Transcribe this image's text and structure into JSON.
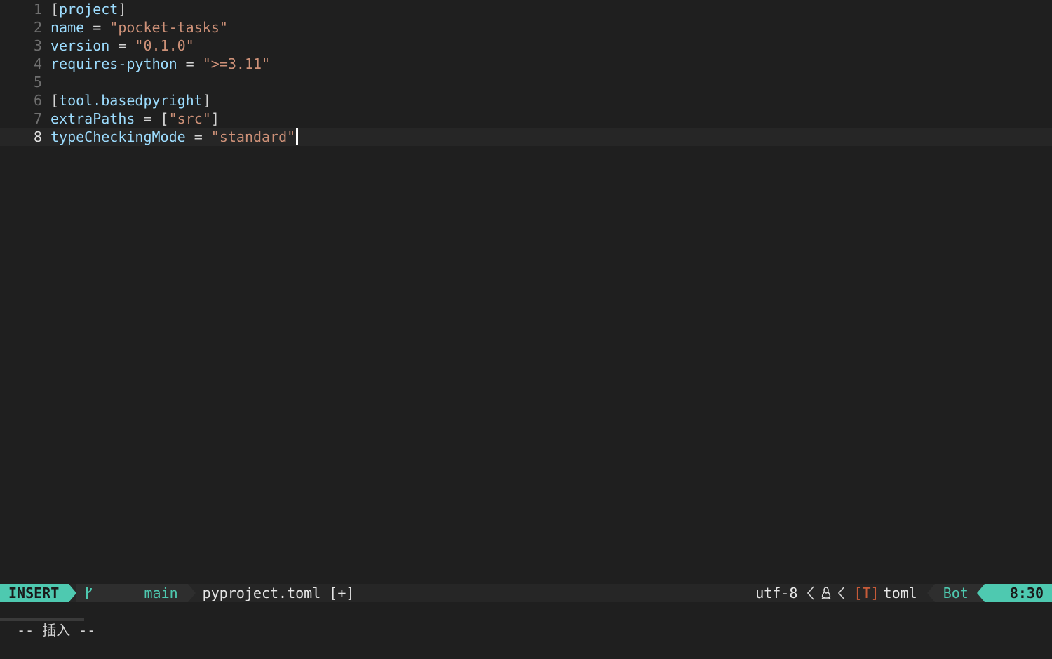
{
  "editor": {
    "lines": [
      {
        "num": "1",
        "parts": [
          {
            "t": "[",
            "c": "b"
          },
          {
            "t": "project",
            "c": "k"
          },
          {
            "t": "]",
            "c": "b"
          }
        ]
      },
      {
        "num": "2",
        "parts": [
          {
            "t": "name",
            "c": "k"
          },
          {
            "t": " = ",
            "c": "op"
          },
          {
            "t": "\"pocket-tasks\"",
            "c": "s"
          }
        ]
      },
      {
        "num": "3",
        "parts": [
          {
            "t": "version",
            "c": "k"
          },
          {
            "t": " = ",
            "c": "op"
          },
          {
            "t": "\"0.1.0\"",
            "c": "s"
          }
        ]
      },
      {
        "num": "4",
        "parts": [
          {
            "t": "requires-python",
            "c": "k"
          },
          {
            "t": " = ",
            "c": "op"
          },
          {
            "t": "\">=3.11\"",
            "c": "s"
          }
        ]
      },
      {
        "num": "5",
        "parts": []
      },
      {
        "num": "6",
        "parts": [
          {
            "t": "[",
            "c": "b"
          },
          {
            "t": "tool.basedpyright",
            "c": "k"
          },
          {
            "t": "]",
            "c": "b"
          }
        ]
      },
      {
        "num": "7",
        "parts": [
          {
            "t": "extraPaths",
            "c": "k"
          },
          {
            "t": " = ",
            "c": "op"
          },
          {
            "t": "[",
            "c": "b"
          },
          {
            "t": "\"src\"",
            "c": "s"
          },
          {
            "t": "]",
            "c": "b"
          }
        ]
      },
      {
        "num": "8",
        "parts": [
          {
            "t": "typeCheckingMode",
            "c": "k"
          },
          {
            "t": " = ",
            "c": "op"
          },
          {
            "t": "\"standard\"",
            "c": "s"
          }
        ],
        "current": true
      }
    ]
  },
  "statusline": {
    "mode": "INSERT",
    "branch": "main",
    "file": "pyproject.toml [+]",
    "encoding": "utf-8",
    "filetype_icon": "[T]",
    "filetype": "toml",
    "position_word": "Bot",
    "cursor": "8:30"
  },
  "cmdline": {
    "text": "-- 插入 --"
  },
  "colors": {
    "accent": "#4ec9b0",
    "key": "#9cdcfe",
    "string": "#ce9178",
    "background": "#1f1f1f"
  },
  "icons": {
    "branch": "git-branch-icon",
    "os": "linux-tux-icon",
    "filetype": "toml-file-icon"
  }
}
